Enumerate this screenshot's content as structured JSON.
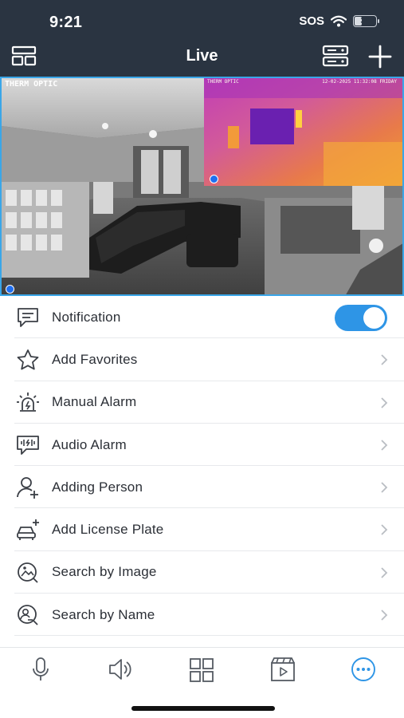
{
  "status_bar": {
    "time": "9:21",
    "sos": "SOS",
    "battery": "34",
    "battery_level": 0.34
  },
  "nav": {
    "title": "Live",
    "left_icon": "layout-icon",
    "right_icons": [
      "device-list-icon",
      "plus-icon"
    ]
  },
  "video": {
    "camera_label": "THERM OPTIC",
    "pip_label": "THERM OPTIC",
    "pip_timestamp": "12-02-2025 11:32:08 FRIDAY"
  },
  "menu": {
    "items": [
      {
        "label": "Notification",
        "icon": "chat-icon",
        "toggle_on": true
      },
      {
        "label": "Add Favorites",
        "icon": "star-icon"
      },
      {
        "label": "Manual Alarm",
        "icon": "siren-icon"
      },
      {
        "label": "Audio Alarm",
        "icon": "audio-alarm-icon"
      },
      {
        "label": "Adding Person",
        "icon": "add-person-icon"
      },
      {
        "label": "Add License Plate",
        "icon": "car-plus-icon"
      },
      {
        "label": "Search by Image",
        "icon": "image-search-icon"
      },
      {
        "label": "Search by Name",
        "icon": "name-search-icon"
      }
    ]
  },
  "tabbar": {
    "items": [
      "microphone-icon",
      "speaker-icon",
      "grid-icon",
      "playback-icon",
      "more-icon"
    ],
    "active_index": 4,
    "active_color": "#2e95e6",
    "inactive_color": "#555b63"
  },
  "colors": {
    "header_bg": "#2a3441",
    "accent": "#2e95e6",
    "selection_border": "#3aa6e8"
  }
}
